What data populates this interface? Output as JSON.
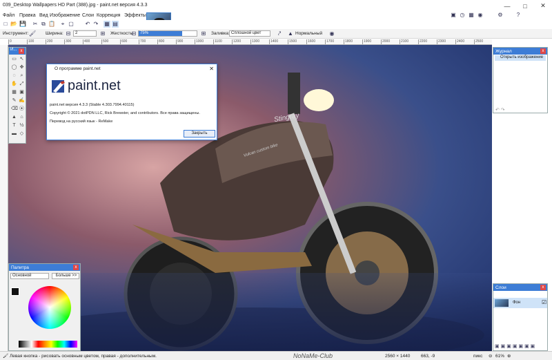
{
  "window": {
    "title": "039_Desktop Wallpapers  HD Part (388).jpg - paint.net версия 4.3.3"
  },
  "menu": [
    "Файл",
    "Правка",
    "Вид",
    "Изображение",
    "Слои",
    "Коррекция",
    "Эффекты"
  ],
  "toolbar": {
    "instrument_label": "Инструмент:",
    "width_label": "Ширина:",
    "width_value": "2",
    "hardness_label": "Жесткость:",
    "hardness_value": "75%",
    "fill_label": "Заливка:",
    "fill_value": "Сплошной цвет",
    "blend_value": "Нормальный"
  },
  "ruler": [
    "0",
    "100",
    "200",
    "300",
    "400",
    "500",
    "600",
    "700",
    "800",
    "900",
    "1000",
    "1100",
    "1200",
    "1300",
    "1400",
    "1500",
    "1600",
    "1700",
    "1800",
    "1900",
    "2000",
    "2100",
    "2200",
    "2300",
    "2400",
    "2500"
  ],
  "tools_window": {
    "title": "И..."
  },
  "about": {
    "title": "О программе paint.net",
    "brand": "paint.net",
    "version_line": "paint.net версия 4.3.3 (Stable 4.303.7994.40115)",
    "copyright": "Copyright © 2021 dotPDN LLC, Rick Brewster, and contributors. Все права защищены.",
    "translation": "Перевод на русский язык - ReMake",
    "close_button": "Закрыть"
  },
  "journal": {
    "title": "Журнал",
    "item": "Открыть изображение"
  },
  "layers": {
    "title": "Слои",
    "layer_name": "Фон"
  },
  "palette": {
    "title": "Палитра",
    "mode": "Основной",
    "more_button": "Больше >>"
  },
  "status": {
    "hint": "Левая кнопка - рисовать основным цветом, правая - дополнительным.",
    "watermark": "NoNaMe-Club",
    "image_size": "2560 × 1440",
    "cursor": "663, -9",
    "units": "пикс",
    "zoom": "61%"
  },
  "canvas": {
    "bike_text_1": "Stingray",
    "bike_text_2": "Vulcan custom bike"
  }
}
